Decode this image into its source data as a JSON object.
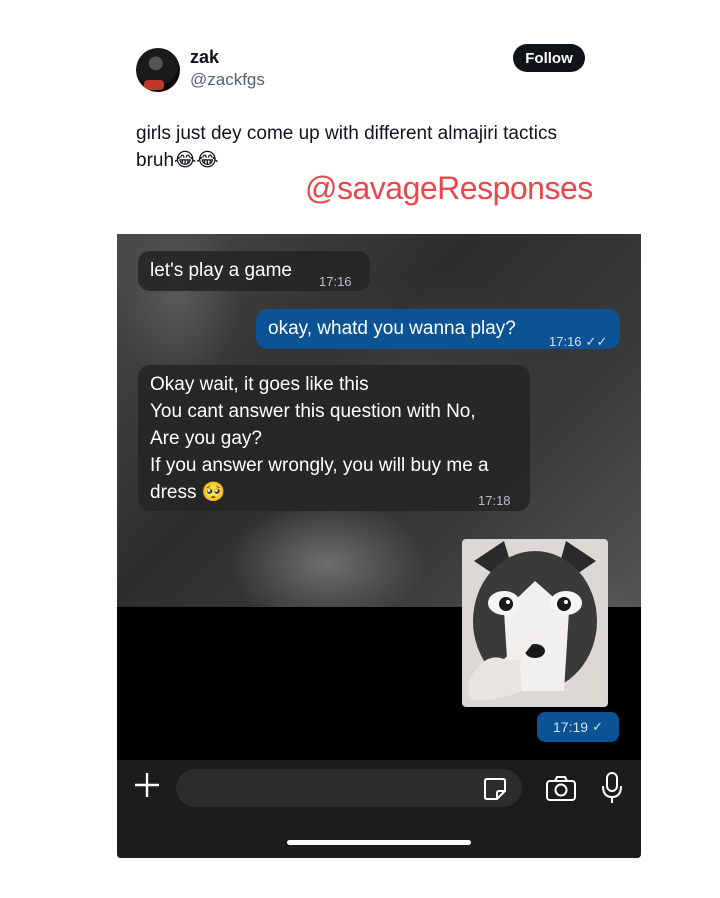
{
  "post": {
    "display_name": "zak",
    "handle": "@zackfgs",
    "follow_label": "Follow",
    "text_line1": "girls just dey come up with different almajiri tactics",
    "text_line2": "bruh😂😂",
    "watermark": "@savageResponses"
  },
  "chat": {
    "messages": [
      {
        "direction": "incoming",
        "lines": [
          "let's play a game"
        ],
        "time": "17:16"
      },
      {
        "direction": "outgoing",
        "lines": [
          "okay, whatd you wanna play?"
        ],
        "time": "17:16",
        "status": "✓✓"
      },
      {
        "direction": "incoming",
        "lines": [
          "Okay wait, it goes like this",
          "You cant answer this question with No,",
          "Are you gay?",
          "If you answer wrongly, you will buy me a",
          "dress 🥺"
        ],
        "time": "17:18"
      },
      {
        "direction": "outgoing",
        "type": "image",
        "image_desc_icon": "husky-sticker",
        "time": "17:19",
        "status": "✓"
      }
    ],
    "input": {
      "placeholder": "",
      "icons": [
        "plus-icon",
        "sticker-icon",
        "camera-icon",
        "mic-icon"
      ]
    }
  },
  "colors": {
    "outgoing_bubble": "#0b5394",
    "incoming_bubble": "#262626",
    "watermark": "#e8474c",
    "follow_button": "#0f1419"
  }
}
